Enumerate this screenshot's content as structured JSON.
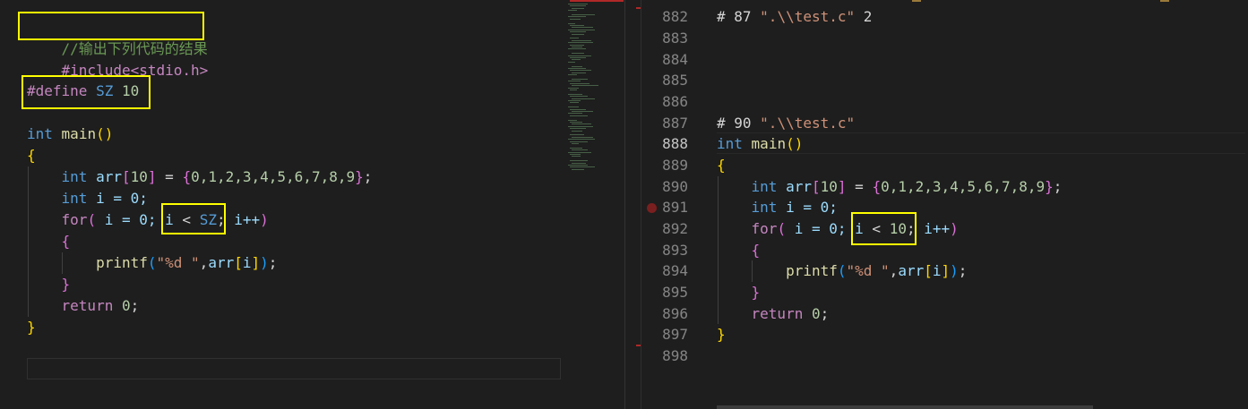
{
  "left_editor": {
    "comment": "//输出下列代码的结果",
    "include": "#include<stdio.h>",
    "define_directive": "#define",
    "define_name": "SZ",
    "define_value": "10",
    "main_type": "int",
    "main_name": "main",
    "main_parens": "()",
    "open_brace": "{",
    "arr_type": "int",
    "arr_name": "arr",
    "arr_size": "10",
    "arr_values": "0,1,2,3,4,5,6,7,8,9",
    "i_decl_type": "int",
    "i_decl_rest": "i = 0;",
    "for_keyword": "for",
    "for_init": " i = 0; ",
    "for_cond_var": "i",
    "for_cond_op": " < ",
    "for_cond_limit": "SZ",
    "for_incr": " i++",
    "inner_open": "{",
    "printf_name": "printf",
    "printf_fmt": "\"%d \"",
    "printf_arg": "arr",
    "printf_index": "i",
    "inner_close": "}",
    "return_keyword": "return",
    "return_value": "0",
    "close_brace": "}"
  },
  "right_editor": {
    "line_numbers": [
      "882",
      "883",
      "884",
      "885",
      "886",
      "887",
      "888",
      "889",
      "890",
      "891",
      "892",
      "893",
      "894",
      "895",
      "896",
      "897",
      "898"
    ],
    "active_line": "888",
    "breakpoint_line": "891",
    "line882_hash": "# 87 ",
    "line882_file": "\".\\\\test.c\"",
    "line882_flag": " 2",
    "line887_hash": "# 90 ",
    "line887_file": "\".\\\\test.c\"",
    "main_type": "int",
    "main_name": "main",
    "main_parens": "()",
    "open_brace": "{",
    "arr_type": "int",
    "arr_name": "arr",
    "arr_size": "10",
    "arr_values": "0,1,2,3,4,5,6,7,8,9",
    "i_decl_type": "int",
    "i_decl_rest": "i = 0;",
    "for_keyword": "for",
    "for_init": " i = 0; ",
    "for_cond_var": "i",
    "for_cond_op": " < ",
    "for_cond_limit": "10",
    "for_incr": " i++",
    "inner_open": "{",
    "printf_name": "printf",
    "printf_fmt": "\"%d \"",
    "printf_arg": "arr",
    "printf_index": "i",
    "inner_close": "}",
    "return_keyword": "return",
    "return_value": "0",
    "close_brace": "}"
  },
  "colors": {
    "background": "#1e1e1e",
    "highlight_box": "#ffff00",
    "keyword": "#569cd6",
    "control": "#c586c0",
    "function": "#dcdcaa",
    "variable": "#9cdcfe",
    "number": "#b5cea8",
    "string": "#ce9178",
    "comment": "#6a9955",
    "line_number": "#858585"
  }
}
